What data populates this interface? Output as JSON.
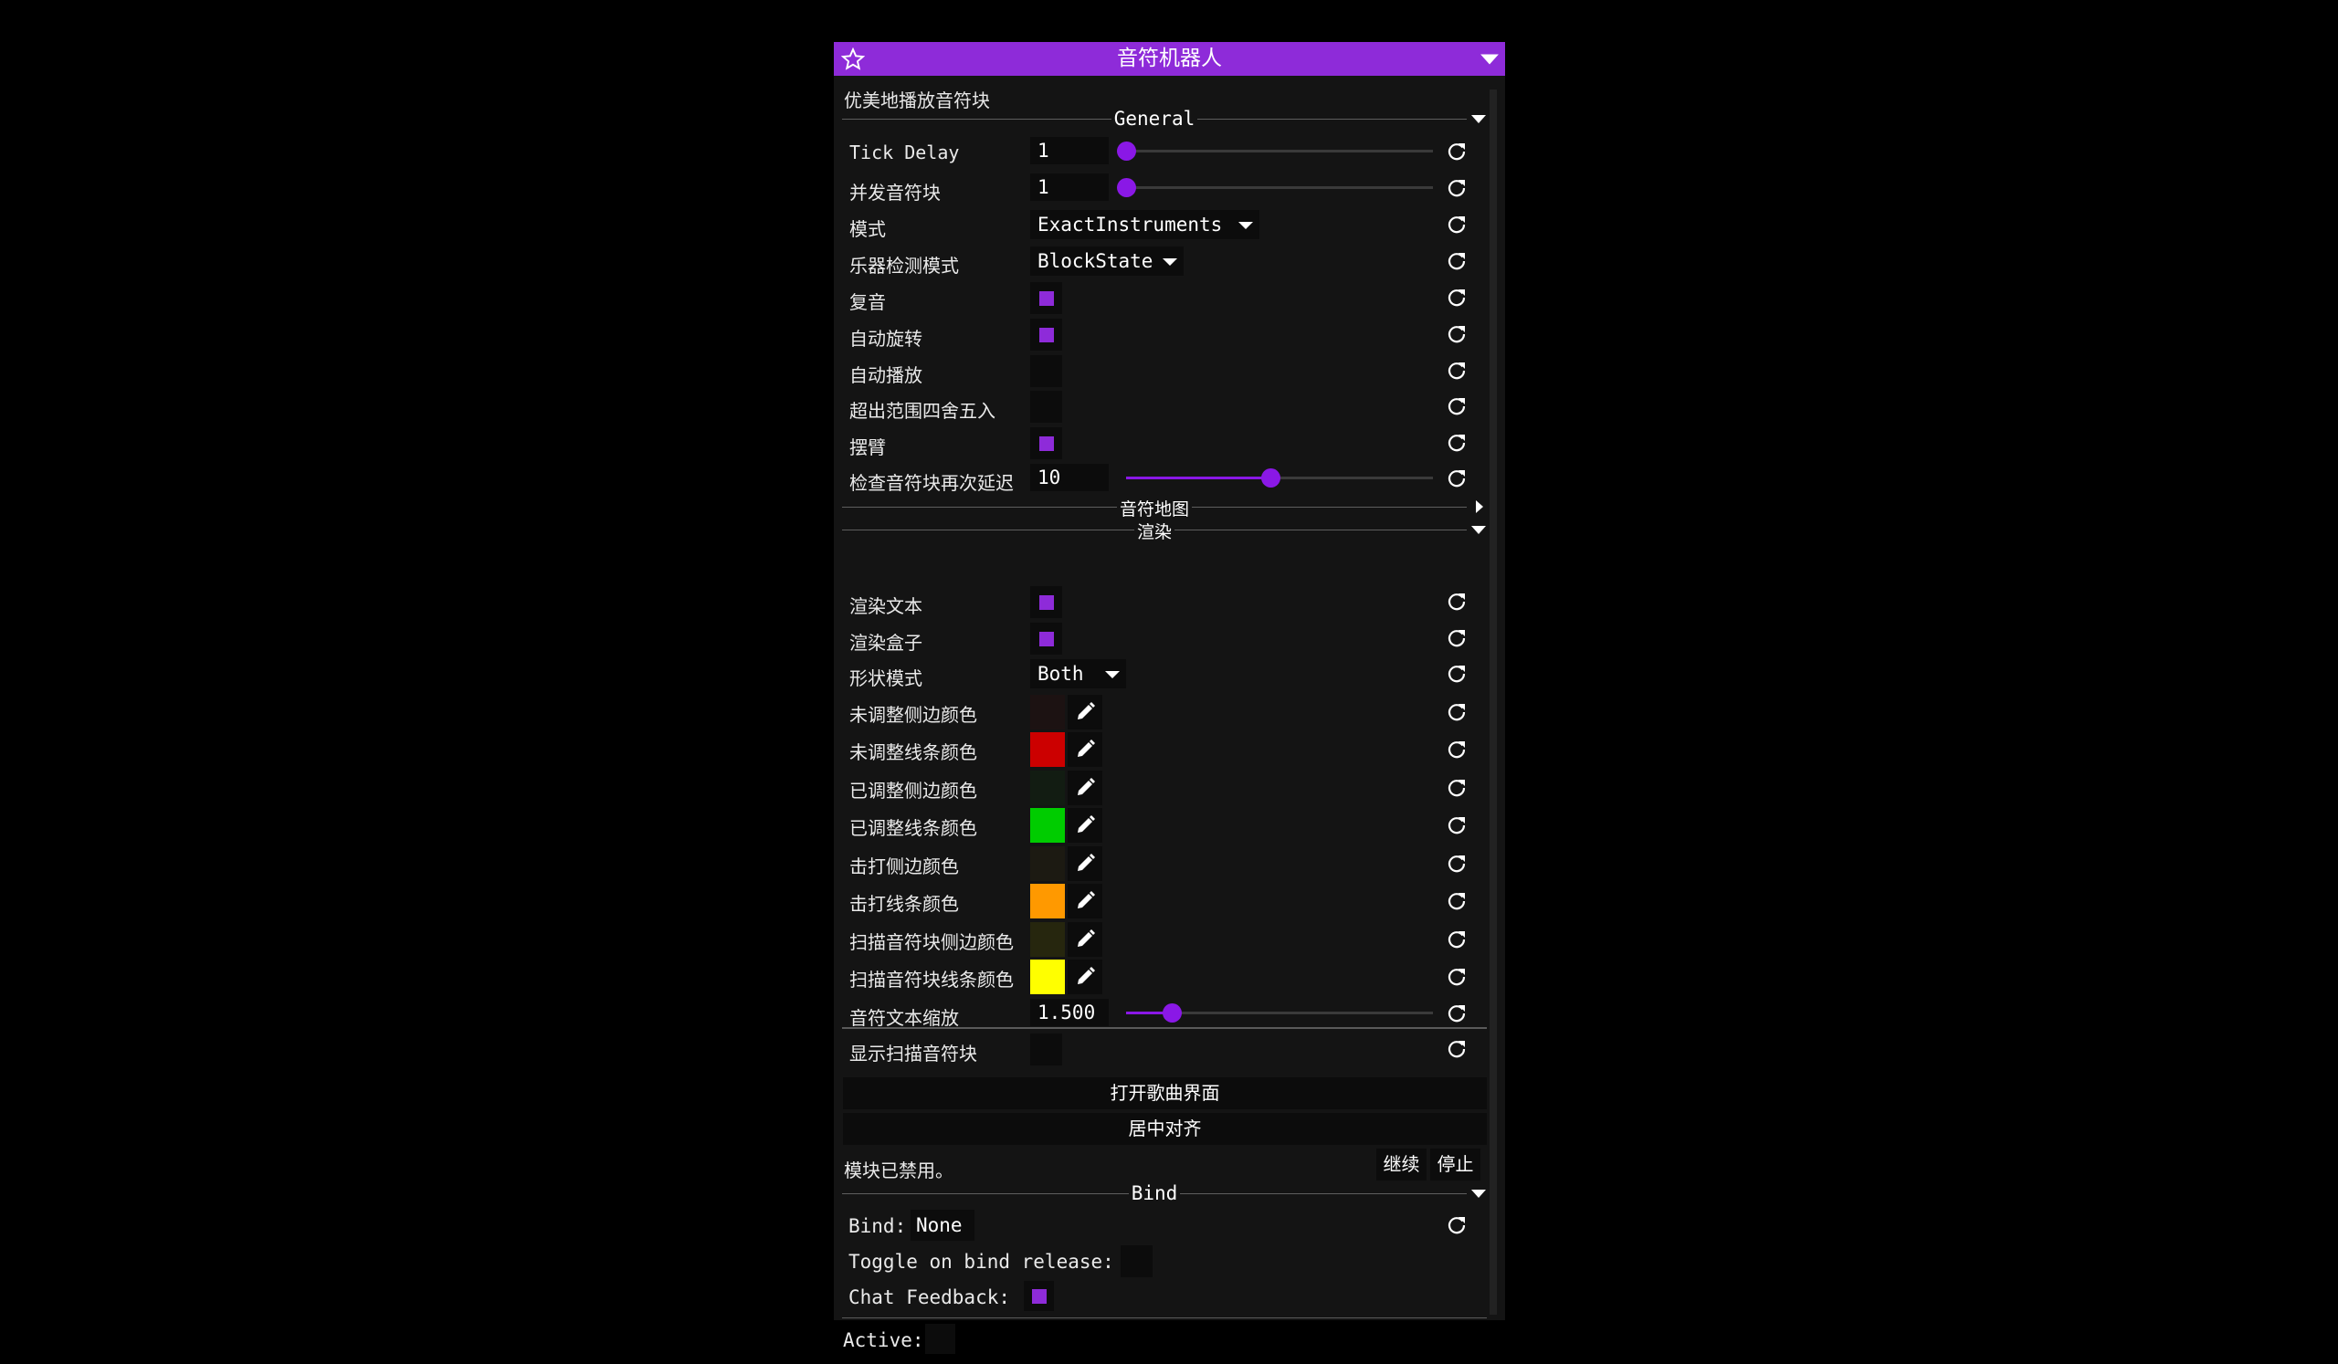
{
  "window": {
    "title": "音符机器人",
    "description": "优美地播放音符块"
  },
  "sections": {
    "general": "General",
    "notemap": "音符地图",
    "render": "渲染",
    "bind": "Bind"
  },
  "colors": {
    "accent": "#8e2bd9",
    "slider": "#8a18e6"
  },
  "general": {
    "tick_delay": {
      "label": "Tick Delay",
      "value": "1",
      "fraction": 0.0
    },
    "concurrent": {
      "label": "并发音符块",
      "value": "1",
      "fraction": 0.0
    },
    "mode": {
      "label": "模式",
      "value": "ExactInstruments"
    },
    "instrument_detect": {
      "label": "乐器检测模式",
      "value": "BlockState"
    },
    "polyphony": {
      "label": "复音",
      "checked": true
    },
    "auto_rotate": {
      "label": "自动旋转",
      "checked": true
    },
    "auto_play": {
      "label": "自动播放",
      "checked": false
    },
    "round_out_of_range": {
      "label": "超出范围四舍五入",
      "checked": false
    },
    "swing_arm": {
      "label": "摆臂",
      "checked": true
    },
    "check_delay": {
      "label": "检查音符块再次延迟",
      "value": "10",
      "fraction": 0.47
    }
  },
  "render": {
    "render_text": {
      "label": "渲染文本",
      "checked": true
    },
    "render_box": {
      "label": "渲染盒子",
      "checked": true
    },
    "shape_mode": {
      "label": "形状模式",
      "value": "Both"
    },
    "untuned_side": {
      "label": "未调整侧边颜色",
      "color": "#1c1212"
    },
    "untuned_line": {
      "label": "未调整线条颜色",
      "color": "#cc0000"
    },
    "tuned_side": {
      "label": "已调整侧边颜色",
      "color": "#121c12"
    },
    "tuned_line": {
      "label": "已调整线条颜色",
      "color": "#00cc00"
    },
    "hit_side": {
      "label": "击打侧边颜色",
      "color": "#1c1a12"
    },
    "hit_line": {
      "label": "击打线条颜色",
      "color": "#ff9900"
    },
    "scan_side": {
      "label": "扫描音符块侧边颜色",
      "color": "#26260e"
    },
    "scan_line": {
      "label": "扫描音符块线条颜色",
      "color": "#ffff00"
    },
    "text_scale": {
      "label": "音符文本缩放",
      "value": "1.500",
      "fraction": 0.15
    },
    "show_scanned": {
      "label": "显示扫描音符块",
      "checked": false
    }
  },
  "buttons": {
    "open_songs": "打开歌曲界面",
    "center": "居中对齐",
    "resume": "继续",
    "stop": "停止"
  },
  "status": {
    "text": "模块已禁用。"
  },
  "bind": {
    "bind_label": "Bind:",
    "bind_value": "None",
    "toggle_label": "Toggle on bind release:",
    "toggle_checked": false,
    "chat_label": "Chat Feedback:",
    "chat_checked": true
  },
  "active": {
    "label": "Active:",
    "checked": false
  }
}
